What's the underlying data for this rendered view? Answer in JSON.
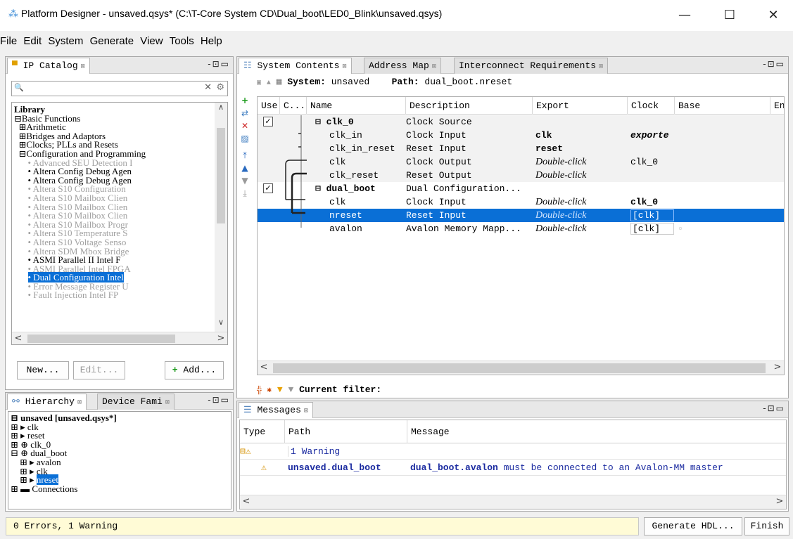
{
  "window": {
    "title": "Platform Designer - unsaved.qsys* (C:\\T-Core System CD\\Dual_boot\\LED0_Blink\\unsaved.qsys)",
    "minimize": "—",
    "maximize": "☐",
    "close": "✕"
  },
  "menu": [
    "File",
    "Edit",
    "System",
    "Generate",
    "View",
    "Tools",
    "Help"
  ],
  "ip_catalog": {
    "tab_label": "IP Catalog",
    "search_placeholder": "",
    "tree": [
      {
        "text": "Library",
        "style": "bold"
      },
      {
        "text": "⊟Basic Functions",
        "style": "normal"
      },
      {
        "text": "  ⊞Arithmetic",
        "style": "normal"
      },
      {
        "text": "  ⊞Bridges and Adaptors",
        "style": "normal"
      },
      {
        "text": "  ⊞Clocks; PLLs and Resets",
        "style": "normal"
      },
      {
        "text": "  ⊟Configuration and Programming",
        "style": "normal"
      },
      {
        "text": "      • Advanced SEU Detection I",
        "style": "grey"
      },
      {
        "text": "      • Altera Config Debug Agen",
        "style": "normal"
      },
      {
        "text": "      • Altera Config Debug Agen",
        "style": "normal"
      },
      {
        "text": "      • Altera S10 Configuration",
        "style": "grey"
      },
      {
        "text": "      • Altera S10 Mailbox Clien",
        "style": "grey"
      },
      {
        "text": "      • Altera S10 Mailbox Clien",
        "style": "grey"
      },
      {
        "text": "      • Altera S10 Mailbox Clien",
        "style": "grey"
      },
      {
        "text": "      • Altera S10 Mailbox Progr",
        "style": "grey"
      },
      {
        "text": "      • Altera S10 Temperature S",
        "style": "grey"
      },
      {
        "text": "      • Altera S10 Voltage Senso",
        "style": "grey"
      },
      {
        "text": "      • Altera SDM Mbox Bridge",
        "style": "grey"
      },
      {
        "text": "      • ASMI Parallel II Intel F",
        "style": "normal"
      },
      {
        "text": "      • ASMI Parallel Intel FPGA",
        "style": "grey"
      },
      {
        "text": "      • Dual Configuration Intel",
        "style": "selected"
      },
      {
        "text": "      • Error Message Register U",
        "style": "grey"
      },
      {
        "text": "      • Fault Injection Intel FP",
        "style": "grey"
      }
    ],
    "new_button": "New...",
    "edit_button": "Edit...",
    "add_button": "Add..."
  },
  "hierarchy": {
    "tab1": "Hierarchy",
    "tab2": "Device Fami",
    "root": "unsaved [unsaved.qsys*]",
    "items": [
      {
        "text": "⊞ ▸ clk",
        "style": "normal"
      },
      {
        "text": "⊞ ▸ reset",
        "style": "normal"
      },
      {
        "text": "⊞ ⊕ clk_0",
        "style": "normal"
      },
      {
        "text": "⊟ ⊕ dual_boot",
        "style": "normal"
      },
      {
        "text": "    ⊞ ▸ avalon",
        "style": "normal"
      },
      {
        "text": "    ⊞ ▸ clk",
        "style": "normal"
      },
      {
        "text": "    ⊞ ▸ ",
        "style": "normal",
        "sel": "nreset"
      },
      {
        "text": "⊞ ▬ Connections",
        "style": "normal"
      }
    ]
  },
  "system_contents": {
    "tabs": [
      "System Contents",
      "Address Map",
      "Interconnect Requirements"
    ],
    "system_label": "System:",
    "system_value": "unsaved",
    "path_label": "Path:",
    "path_value": "dual_boot.nreset",
    "columns": [
      "Use",
      "C...",
      "Name",
      "Description",
      "Export",
      "Clock",
      "Base",
      "En"
    ],
    "rows": [
      {
        "name": "⊟ clk_0",
        "desc": "Clock Source",
        "export": "",
        "clock": "",
        "base": "",
        "bold": true,
        "check": true
      },
      {
        "name": "clk_in",
        "desc": "Clock Input",
        "export": "clk",
        "clock": "exporte",
        "base": ""
      },
      {
        "name": "clk_in_reset",
        "desc": "Reset Input",
        "export": "reset",
        "clock": "",
        "base": ""
      },
      {
        "name": "clk",
        "desc": "Clock Output",
        "export": "Double-click",
        "clock": "clk_0",
        "base": ""
      },
      {
        "name": "clk_reset",
        "desc": "Reset Output",
        "export": "Double-click",
        "clock": "",
        "base": ""
      },
      {
        "name": "⊟ dual_boot",
        "desc": "Dual Configuration...",
        "export": "",
        "clock": "",
        "base": "",
        "bold": true,
        "check": true
      },
      {
        "name": "clk",
        "desc": "Clock Input",
        "export": "Double-click",
        "clock": "clk_0",
        "base": ""
      },
      {
        "name": "nreset",
        "desc": "Reset Input",
        "export": "Double-click",
        "clock": "[clk]",
        "base": "",
        "selected": true
      },
      {
        "name": "avalon",
        "desc": "Avalon Memory Mapp...",
        "export": "Double-click",
        "clock": "[clk]",
        "base": "▫"
      }
    ],
    "filter_label": "Current filter:"
  },
  "messages": {
    "tab_label": "Messages",
    "columns": [
      "Type",
      "Path",
      "Message"
    ],
    "group": "1 Warning",
    "warning_path": "unsaved.dual_boot",
    "warning_msg_bold": "dual_boot.avalon",
    "warning_msg_rest": " must be connected to an Avalon-MM master"
  },
  "status": {
    "text": "0 Errors, 1 Warning",
    "generate_button": "Generate HDL...",
    "finish_button": "Finish"
  }
}
